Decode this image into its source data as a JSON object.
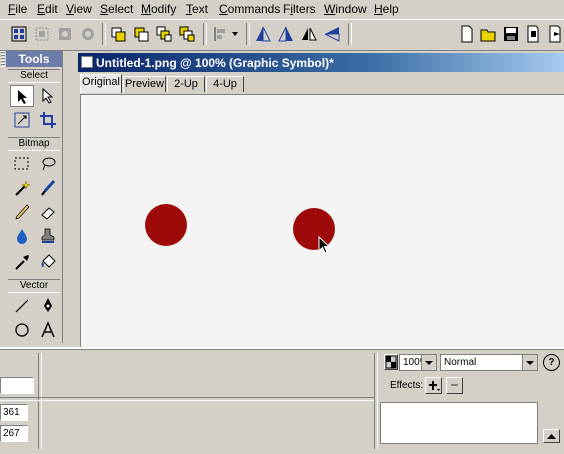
{
  "menu": {
    "items": [
      {
        "label": "File",
        "key": "F"
      },
      {
        "label": "Edit",
        "key": "E"
      },
      {
        "label": "View",
        "key": "V"
      },
      {
        "label": "Select",
        "key": "S"
      },
      {
        "label": "Modify",
        "key": "M"
      },
      {
        "label": "Text",
        "key": "T"
      },
      {
        "label": "Commands",
        "key": "C"
      },
      {
        "label": "Filters",
        "key": "i"
      },
      {
        "label": "Window",
        "key": "W"
      },
      {
        "label": "Help",
        "key": "H"
      }
    ]
  },
  "toolbar": {
    "icons": [
      "group-icon",
      "ungroup-icon",
      "join-icon",
      "split-icon",
      "bring-to-front-icon",
      "bring-forward-icon",
      "send-backward-icon",
      "send-to-back-icon",
      "align-icon",
      "rotate-ccw-icon",
      "rotate-cw-icon",
      "flip-horizontal-icon",
      "flip-vertical-icon",
      "new-file-icon",
      "open-icon",
      "save-icon",
      "import-icon",
      "export-icon"
    ]
  },
  "tools": {
    "title": "Tools",
    "sections": {
      "select": "Select",
      "bitmap": "Bitmap",
      "vector": "Vector"
    }
  },
  "document": {
    "title": "Untitled-1.png @ 100% (Graphic Symbol)*",
    "tabs": [
      {
        "label": "Original",
        "active": true
      },
      {
        "label": "Preview",
        "active": false
      },
      {
        "label": "2-Up",
        "active": false
      },
      {
        "label": "4-Up",
        "active": false
      }
    ],
    "canvas_color": "#f4f4f4",
    "circle_color": "#9e0a0a"
  },
  "properties": {
    "x_value": "361",
    "y_value": "267",
    "opacity": "100%",
    "blend_mode": "Normal",
    "effects_label": "Effects:",
    "help_label": "?"
  }
}
